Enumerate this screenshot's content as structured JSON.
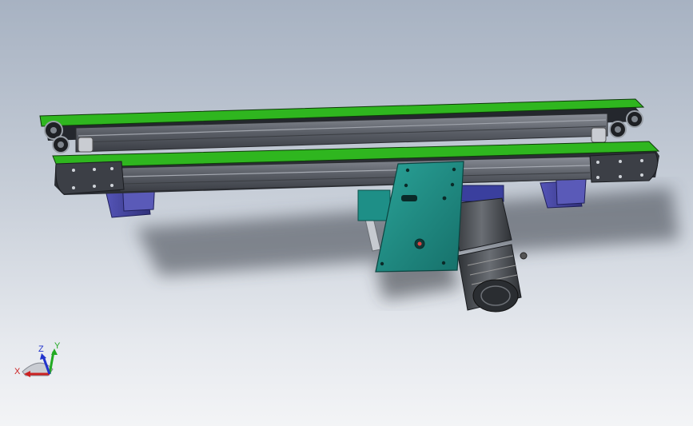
{
  "viewport": {
    "background_top": "#a7b2c2",
    "background_bottom": "#f3f4f6"
  },
  "model": {
    "belt_color": "#2fb61f",
    "frame_color": "#5f6470",
    "bracket_color": "#3f3f9a",
    "motor_plate_color": "#1e8f87",
    "motor_color": "#4a4e54"
  },
  "triad": {
    "x_label": "X",
    "y_label": "Y",
    "z_label": "Z",
    "x_color": "#cc2222",
    "y_color": "#22aa22",
    "z_color": "#2233cc"
  }
}
